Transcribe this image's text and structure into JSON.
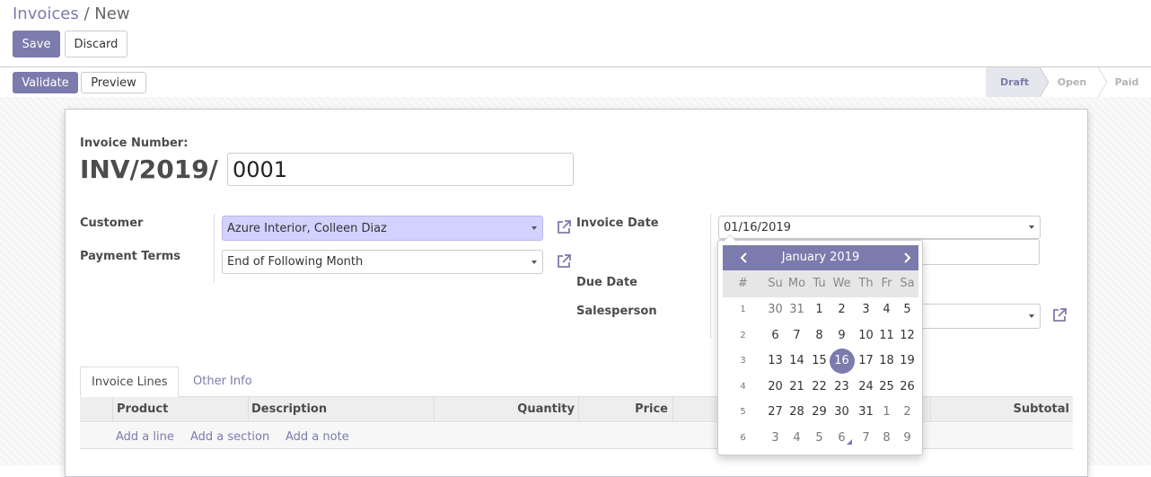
{
  "breadcrumb": {
    "parent": "Invoices",
    "separator": "/",
    "current": "New"
  },
  "actions": {
    "save": "Save",
    "discard": "Discard"
  },
  "header_buttons": {
    "validate": "Validate",
    "preview": "Preview"
  },
  "status_stages": [
    {
      "label": "Draft",
      "active": true
    },
    {
      "label": "Open",
      "active": false
    },
    {
      "label": "Paid",
      "active": false
    }
  ],
  "invoice": {
    "number_label": "Invoice Number:",
    "number_prefix": "INV/2019/",
    "number_suffix": "0001"
  },
  "form": {
    "customer_label": "Customer",
    "customer_value": "Azure Interior, Colleen Diaz",
    "payment_terms_label": "Payment Terms",
    "payment_terms_value": "End of Following Month",
    "invoice_date_label": "Invoice Date",
    "invoice_date_value": "01/16/2019",
    "due_date_label": "Due Date",
    "salesperson_label": "Salesperson"
  },
  "tabs": [
    {
      "label": "Invoice Lines",
      "active": true
    },
    {
      "label": "Other Info",
      "active": false
    }
  ],
  "table": {
    "columns": [
      "Product",
      "Description",
      "Quantity",
      "Price",
      "Subtotal"
    ],
    "add_links": [
      "Add a line",
      "Add a section",
      "Add a note"
    ]
  },
  "datepicker": {
    "title": "January 2019",
    "weekday_headers": [
      "#",
      "Su",
      "Mo",
      "Tu",
      "We",
      "Th",
      "Fr",
      "Sa"
    ],
    "weeks": [
      {
        "week": "1",
        "days": [
          "30",
          "31",
          "1",
          "2",
          "3",
          "4",
          "5"
        ]
      },
      {
        "week": "2",
        "days": [
          "6",
          "7",
          "8",
          "9",
          "10",
          "11",
          "12"
        ]
      },
      {
        "week": "3",
        "days": [
          "13",
          "14",
          "15",
          "16",
          "17",
          "18",
          "19"
        ]
      },
      {
        "week": "4",
        "days": [
          "20",
          "21",
          "22",
          "23",
          "24",
          "25",
          "26"
        ]
      },
      {
        "week": "5",
        "days": [
          "27",
          "28",
          "29",
          "30",
          "31",
          "1",
          "2"
        ]
      },
      {
        "week": "6",
        "days": [
          "3",
          "4",
          "5",
          "6",
          "7",
          "8",
          "9"
        ]
      }
    ],
    "selected_day": "16"
  },
  "colors": {
    "primary": "#7c7bad",
    "highlight_input": "#d2d2ff",
    "border": "#cccccc"
  },
  "icons": [
    "external-link-icon",
    "chevron-left-icon",
    "chevron-right-icon",
    "dropdown-caret-icon"
  ]
}
